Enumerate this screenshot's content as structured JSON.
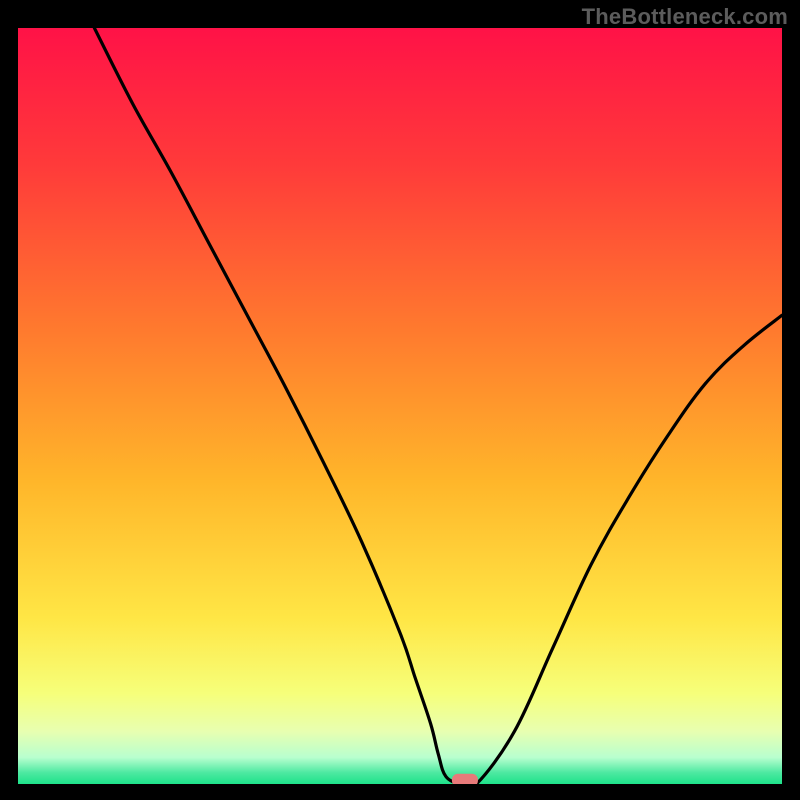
{
  "watermark": "TheBottleneck.com",
  "colors": {
    "background": "#000000",
    "curve": "#000000",
    "marker_fill": "#e77a7a",
    "gradient_stops": [
      {
        "offset": 0.0,
        "color": "#ff1247"
      },
      {
        "offset": 0.18,
        "color": "#ff3a3a"
      },
      {
        "offset": 0.4,
        "color": "#ff7a2e"
      },
      {
        "offset": 0.6,
        "color": "#ffb62a"
      },
      {
        "offset": 0.78,
        "color": "#ffe645"
      },
      {
        "offset": 0.88,
        "color": "#f6ff7a"
      },
      {
        "offset": 0.93,
        "color": "#e8ffb0"
      },
      {
        "offset": 0.965,
        "color": "#b8ffcf"
      },
      {
        "offset": 0.985,
        "color": "#4de9a1"
      },
      {
        "offset": 1.0,
        "color": "#1ee28a"
      }
    ]
  },
  "chart_data": {
    "type": "line",
    "title": "",
    "xlabel": "",
    "ylabel": "",
    "xlim": [
      0,
      100
    ],
    "ylim": [
      0,
      100
    ],
    "grid": false,
    "legend": false,
    "series": [
      {
        "name": "bottleneck-curve",
        "x": [
          10,
          15,
          20,
          25,
          30,
          35,
          40,
          45,
          50,
          52,
          54,
          55,
          56,
          58,
          60,
          65,
          70,
          75,
          80,
          85,
          90,
          95,
          100
        ],
        "values": [
          100,
          90,
          81,
          71.5,
          62,
          52.5,
          42.5,
          32,
          20,
          14,
          8,
          4,
          1,
          0,
          0,
          7,
          18,
          29,
          38,
          46,
          53,
          58,
          62
        ]
      }
    ],
    "annotations": [
      {
        "name": "min-marker",
        "x": 58.5,
        "y": 0.5,
        "shape": "rounded-rect",
        "color": "#e77a7a"
      }
    ]
  }
}
